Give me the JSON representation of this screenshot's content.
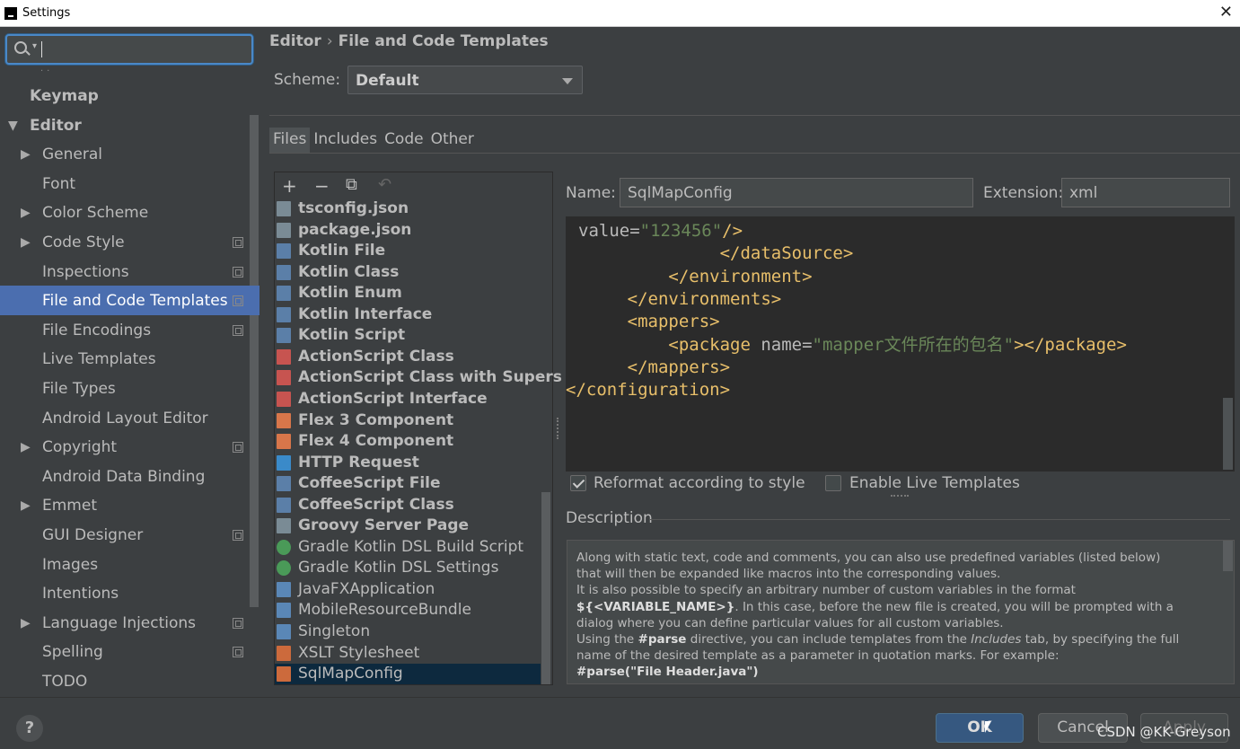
{
  "window": {
    "title": "Settings"
  },
  "sidebar": {
    "search_value": "",
    "items": [
      {
        "label": "Keymap",
        "bold": true,
        "arrow": ""
      },
      {
        "label": "Editor",
        "bold": true,
        "arrow": "expanded"
      },
      {
        "label": "General",
        "arrow": "collapsed",
        "cfg": false
      },
      {
        "label": "Font",
        "arrow": "",
        "cfg": false
      },
      {
        "label": "Color Scheme",
        "arrow": "collapsed",
        "cfg": false
      },
      {
        "label": "Code Style",
        "arrow": "collapsed",
        "cfg": true
      },
      {
        "label": "Inspections",
        "arrow": "",
        "cfg": true
      },
      {
        "label": "File and Code Templates",
        "arrow": "",
        "cfg": true,
        "selected": true
      },
      {
        "label": "File Encodings",
        "arrow": "",
        "cfg": true
      },
      {
        "label": "Live Templates",
        "arrow": "",
        "cfg": false
      },
      {
        "label": "File Types",
        "arrow": "",
        "cfg": false
      },
      {
        "label": "Android Layout Editor",
        "arrow": "",
        "cfg": false
      },
      {
        "label": "Copyright",
        "arrow": "collapsed",
        "cfg": true
      },
      {
        "label": "Android Data Binding",
        "arrow": "",
        "cfg": false
      },
      {
        "label": "Emmet",
        "arrow": "collapsed",
        "cfg": false
      },
      {
        "label": "GUI Designer",
        "arrow": "",
        "cfg": true
      },
      {
        "label": "Images",
        "arrow": "",
        "cfg": false
      },
      {
        "label": "Intentions",
        "arrow": "",
        "cfg": false
      },
      {
        "label": "Language Injections",
        "arrow": "collapsed",
        "cfg": true
      },
      {
        "label": "Spelling",
        "arrow": "",
        "cfg": true
      },
      {
        "label": "TODO",
        "arrow": "",
        "cfg": false
      }
    ]
  },
  "breadcrumb": {
    "parent": "Editor",
    "current": "File and Code Templates"
  },
  "scheme": {
    "label": "Scheme:",
    "value": "Default"
  },
  "tabs": [
    "Files",
    "Includes",
    "Code",
    "Other"
  ],
  "templates": [
    {
      "label": "tsconfig.json",
      "bold": true,
      "icon": "js"
    },
    {
      "label": "package.json",
      "bold": true,
      "icon": "js"
    },
    {
      "label": "Kotlin File",
      "bold": true,
      "icon": "kt"
    },
    {
      "label": "Kotlin Class",
      "bold": true,
      "icon": "kt"
    },
    {
      "label": "Kotlin Enum",
      "bold": true,
      "icon": "kt"
    },
    {
      "label": "Kotlin Interface",
      "bold": true,
      "icon": "kt"
    },
    {
      "label": "Kotlin Script",
      "bold": true,
      "icon": "kt"
    },
    {
      "label": "ActionScript Class",
      "bold": true,
      "icon": "as"
    },
    {
      "label": "ActionScript Class with Supers",
      "bold": true,
      "icon": "as"
    },
    {
      "label": "ActionScript Interface",
      "bold": true,
      "icon": "as"
    },
    {
      "label": "Flex 3 Component",
      "bold": true,
      "icon": "fx"
    },
    {
      "label": "Flex 4 Component",
      "bold": true,
      "icon": "fx"
    },
    {
      "label": "HTTP Request",
      "bold": true,
      "icon": "api"
    },
    {
      "label": "CoffeeScript File",
      "bold": true,
      "icon": "kt"
    },
    {
      "label": "CoffeeScript Class",
      "bold": true,
      "icon": "kt"
    },
    {
      "label": "Groovy Server Page",
      "bold": true,
      "icon": "js"
    },
    {
      "label": "Gradle Kotlin DSL Build Script",
      "bold": false,
      "icon": "gr"
    },
    {
      "label": "Gradle Kotlin DSL Settings",
      "bold": false,
      "icon": "gr"
    },
    {
      "label": "JavaFXApplication",
      "bold": false,
      "icon": "jv"
    },
    {
      "label": "MobileResourceBundle",
      "bold": false,
      "icon": "jv"
    },
    {
      "label": "Singleton",
      "bold": false,
      "icon": "jv"
    },
    {
      "label": "XSLT Stylesheet",
      "bold": false,
      "icon": "xs"
    },
    {
      "label": "SqlMapConfig",
      "bold": false,
      "icon": "xs",
      "selected": true
    }
  ],
  "name_field": {
    "label": "Name:",
    "value": "SqlMapConfig"
  },
  "extension_field": {
    "label": "Extension:",
    "value": "xml"
  },
  "editor_lines": [
    {
      "indent": "",
      "parts": [
        [
          "attc",
          "value="
        ],
        [
          "strc",
          "\"123456\""
        ],
        [
          "tagc",
          "/>"
        ]
      ]
    },
    {
      "indent": "               ",
      "parts": [
        [
          "tagc",
          "</dataSource>"
        ]
      ]
    },
    {
      "indent": "          ",
      "parts": [
        [
          "tagc",
          "</environment>"
        ]
      ]
    },
    {
      "indent": "      ",
      "parts": [
        [
          "tagc",
          "</environments>"
        ]
      ]
    },
    {
      "indent": "      ",
      "parts": [
        [
          "tagc",
          "<mappers>"
        ]
      ]
    },
    {
      "indent": "          ",
      "parts": [
        [
          "tagc",
          "<package "
        ],
        [
          "attc",
          "name="
        ],
        [
          "strc",
          "\"mapper文件所在的包名\""
        ],
        [
          "tagc",
          "></package>"
        ]
      ]
    },
    {
      "indent": "      ",
      "parts": [
        [
          "tagc",
          "</mappers>"
        ]
      ]
    },
    {
      "indent": "",
      "parts": [
        [
          "tagc",
          "</configuration>"
        ]
      ]
    }
  ],
  "options": {
    "reformat": {
      "label": "Reformat according to style",
      "checked": true
    },
    "live_templates": {
      "label": "Enable Live Templates",
      "checked": false
    }
  },
  "description": {
    "label": "Description",
    "p1": "Along with static text, code and comments, you can also use predefined variables (listed below) that will then be expanded like macros into the corresponding values.",
    "p2a": "It is also possible to specify an arbitrary number of custom variables in the format ",
    "p2b": "${<VARIABLE_NAME>}",
    "p2c": ". In this case, before the new file is created, you will be prompted with a dialog where you can define particular values for all custom variables.",
    "p3a": "Using the ",
    "p3b": "#parse",
    "p3c": " directive, you can include templates from the ",
    "p3d": "Includes",
    "p3e": " tab, by specifying the full name of the desired template as a parameter in quotation marks. For example:",
    "p4": "#parse(\"File Header.java\")"
  },
  "buttons": {
    "ok": "OK",
    "cancel": "Cancel",
    "apply": "Apply"
  },
  "watermark": "CSDN @KK-Greyson",
  "colors": {
    "accent": "#4b6eaf",
    "background": "#3c3f41",
    "editor_bg": "#2b2b2b",
    "tag": "#e8bf6a",
    "string": "#6a8759"
  }
}
